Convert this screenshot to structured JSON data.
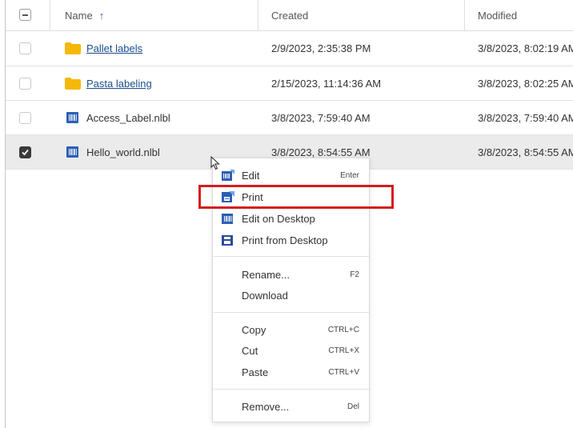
{
  "table": {
    "headers": {
      "name": "Name",
      "sort_arrow": "↑",
      "created": "Created",
      "modified": "Modified"
    },
    "rows": [
      {
        "name": "Pallet labels",
        "type": "folder",
        "created": "2/9/2023, 2:35:38 PM",
        "modified": "3/8/2023, 8:02:19 AM",
        "checked": false
      },
      {
        "name": "Pasta labeling",
        "type": "folder",
        "created": "2/15/2023, 11:14:36 AM",
        "modified": "3/8/2023, 8:02:25 AM",
        "checked": false
      },
      {
        "name": "Access_Label.nlbl",
        "type": "label",
        "created": "3/8/2023, 7:59:40 AM",
        "modified": "3/8/2023, 7:59:40 AM",
        "checked": false
      },
      {
        "name": "Hello_world.nlbl",
        "type": "label",
        "created": "3/8/2023, 8:54:55 AM",
        "modified": "3/8/2023, 8:54:55 AM",
        "checked": true
      }
    ]
  },
  "context_menu": {
    "edit": {
      "label": "Edit",
      "shortcut": "Enter"
    },
    "print": {
      "label": "Print"
    },
    "edit_desktop": {
      "label": "Edit on Desktop"
    },
    "print_desktop": {
      "label": "Print from Desktop"
    },
    "rename": {
      "label": "Rename...",
      "shortcut": "F2"
    },
    "download": {
      "label": "Download"
    },
    "copy": {
      "label": "Copy",
      "shortcut": "CTRL+C"
    },
    "cut": {
      "label": "Cut",
      "shortcut": "CTRL+X"
    },
    "paste": {
      "label": "Paste",
      "shortcut": "CTRL+V"
    },
    "remove": {
      "label": "Remove...",
      "shortcut": "Del"
    }
  },
  "colors": {
    "highlight": "#d51d1d",
    "folder": "#f5b80a",
    "label_icon": "#2b5fb3",
    "link": "#1a4e8a",
    "selected_row": "#ebebeb"
  },
  "icons": [
    "folder-icon",
    "label-file-icon",
    "edit-icon",
    "print-icon",
    "edit-desktop-icon",
    "print-desktop-icon",
    "mouse-cursor-icon"
  ]
}
